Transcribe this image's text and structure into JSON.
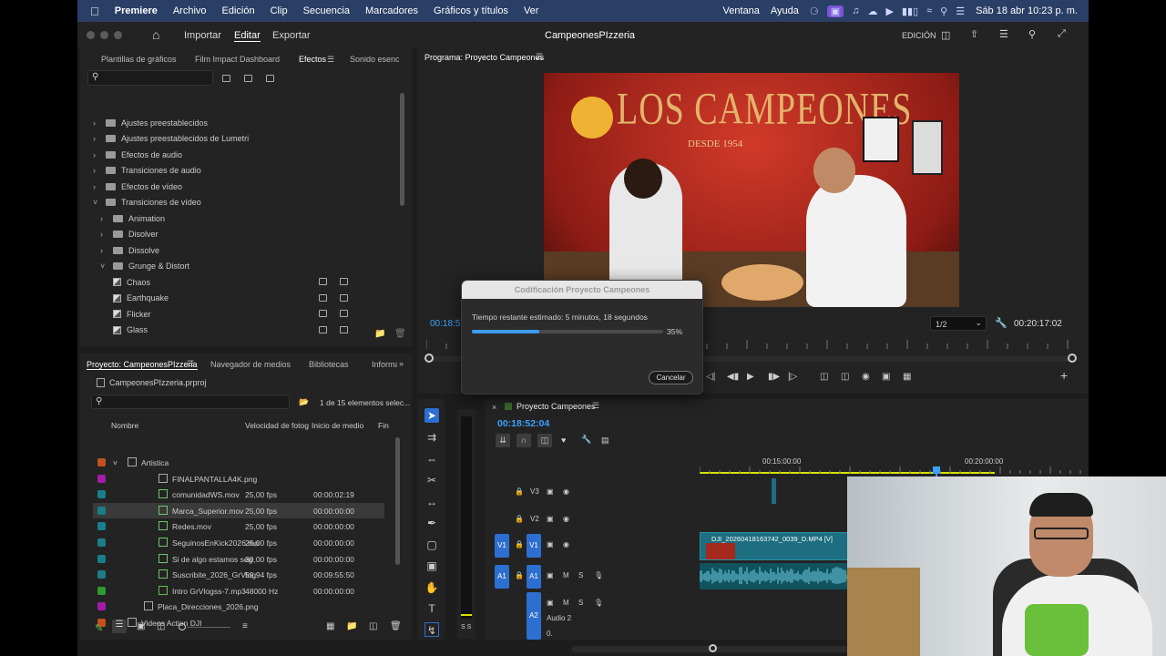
{
  "menubar": {
    "apple": "",
    "items": [
      "Premiere",
      "Archivo",
      "Edición",
      "Clip",
      "Secuencia",
      "Marcadores",
      "Gráficos y títulos",
      "Ver"
    ],
    "right_items": [
      "Ventana",
      "Ayuda"
    ],
    "clock": "Sáb 18 abr 10:23 p. m."
  },
  "app": {
    "title": "CampeonesPIzzeria",
    "home_label": "",
    "nav": [
      "Importar",
      "Editar",
      "Exportar"
    ],
    "workspace": "EDICIÓN"
  },
  "effects_panel": {
    "tabs": [
      "Plantillas de gráficos",
      "Film Impact Dashboard",
      "Efectos",
      "Sonido esencia"
    ],
    "tree": [
      {
        "label": "Ajustes preestablecidos",
        "level": 0,
        "type": "folder",
        "open": false
      },
      {
        "label": "Ajustes preestablecidos de Lumetri",
        "level": 0,
        "type": "folder",
        "open": false
      },
      {
        "label": "Efectos de audio",
        "level": 0,
        "type": "folder",
        "open": false
      },
      {
        "label": "Transiciones de audio",
        "level": 0,
        "type": "folder",
        "open": false
      },
      {
        "label": "Efectos de vídeo",
        "level": 0,
        "type": "folder",
        "open": false
      },
      {
        "label": "Transiciones de vídeo",
        "level": 0,
        "type": "folder",
        "open": true
      },
      {
        "label": "Animation",
        "level": 1,
        "type": "folder",
        "open": false
      },
      {
        "label": "Disolver",
        "level": 1,
        "type": "folder",
        "open": false
      },
      {
        "label": "Dissolve",
        "level": 1,
        "type": "folder",
        "open": false
      },
      {
        "label": "Grunge & Distort",
        "level": 1,
        "type": "folder",
        "open": true
      },
      {
        "label": "Chaos",
        "level": 2,
        "type": "effect"
      },
      {
        "label": "Earthquake",
        "level": 2,
        "type": "effect"
      },
      {
        "label": "Flicker",
        "level": 2,
        "type": "effect"
      },
      {
        "label": "Glass",
        "level": 2,
        "type": "effect"
      }
    ]
  },
  "project_panel": {
    "tabs": [
      "Proyecto: CampeonesPIzzeria",
      "Navegador de medios",
      "Bibliotecas",
      "Informa"
    ],
    "file": "CampeonesPIzzeria.prproj",
    "selection_count": "1 de 15 elementos selec...",
    "columns": [
      "Nombre",
      "Velocidad de fotogr",
      "Inicio de medio",
      "Fin"
    ],
    "rows": [
      {
        "name": "Artistica",
        "fps": "",
        "start": "",
        "color": "#c1511d",
        "kind": "folder"
      },
      {
        "name": "FINALPANTALLA4K.png",
        "fps": "",
        "start": "",
        "color": "#a21ca8",
        "kind": "image"
      },
      {
        "name": "comunidadWS.mov",
        "fps": "25,00 fps",
        "start": "00:00:02:19",
        "color": "#1a7d8a",
        "kind": "clip"
      },
      {
        "name": "Marca_Superior.mov",
        "fps": "25,00 fps",
        "start": "00:00:00:00",
        "color": "#1a7d8a",
        "kind": "clip"
      },
      {
        "name": "Redes.mov",
        "fps": "25,00 fps",
        "start": "00:00:00:00",
        "color": "#1a7d8a",
        "kind": "clip"
      },
      {
        "name": "SeguinosEnKick2026.mo",
        "fps": "25,00 fps",
        "start": "00:00:00:00",
        "color": "#1a7d8a",
        "kind": "clip"
      },
      {
        "name": "Si de algo estamos seg",
        "fps": "30,00 fps",
        "start": "00:00:00:00",
        "color": "#1a7d8a",
        "kind": "clip"
      },
      {
        "name": "Suscribite_2026_GrVlog",
        "fps": "59,94 fps",
        "start": "00:09:55:50",
        "color": "#1a7d8a",
        "kind": "clip"
      },
      {
        "name": "Intro GrVlogss-7.mp3",
        "fps": "48000 Hz",
        "start": "00:00:00:00",
        "color": "#2f9a2f",
        "kind": "audio"
      },
      {
        "name": "Placa_Direcciones_2026.png",
        "fps": "",
        "start": "",
        "color": "#a21ca8",
        "kind": "image"
      },
      {
        "name": "Videos Action DJI",
        "fps": "",
        "start": "",
        "color": "#c1511d",
        "kind": "folder"
      }
    ]
  },
  "program_monitor": {
    "tab": "Programa: Proyecto Campeones",
    "timecode_left": "00:18:5",
    "resolution": "1/2",
    "timecode_right": "00:20:17:02",
    "sign_text": "LOS CAMPEONES",
    "sign_sub": "DESDE 1954"
  },
  "export_dialog": {
    "title": "Codificación Proyecto Campeones",
    "status": "Tiempo restante estimado: 5 minutos, 18 segundos",
    "percent_label": "35%",
    "progress": 0.35,
    "cancel": "Cancelar"
  },
  "timeline": {
    "tab": "Proyecto Campeones",
    "timecode": "00:18:52:04",
    "ruler": [
      "00:15:00:00",
      "00:20:00:00"
    ],
    "tracks": [
      {
        "id": "V3",
        "label": "V3"
      },
      {
        "id": "V2",
        "label": "V2"
      },
      {
        "id": "V1",
        "label": "V1",
        "src": "V1"
      },
      {
        "id": "A1",
        "label": "A1",
        "src": "A1"
      },
      {
        "id": "A2",
        "label": "A2",
        "name": "Audio 2",
        "vol": "0."
      }
    ],
    "clip_name": "DJI_20260418163742_0039_D.MP4 [V]",
    "meter_label": "S S"
  }
}
